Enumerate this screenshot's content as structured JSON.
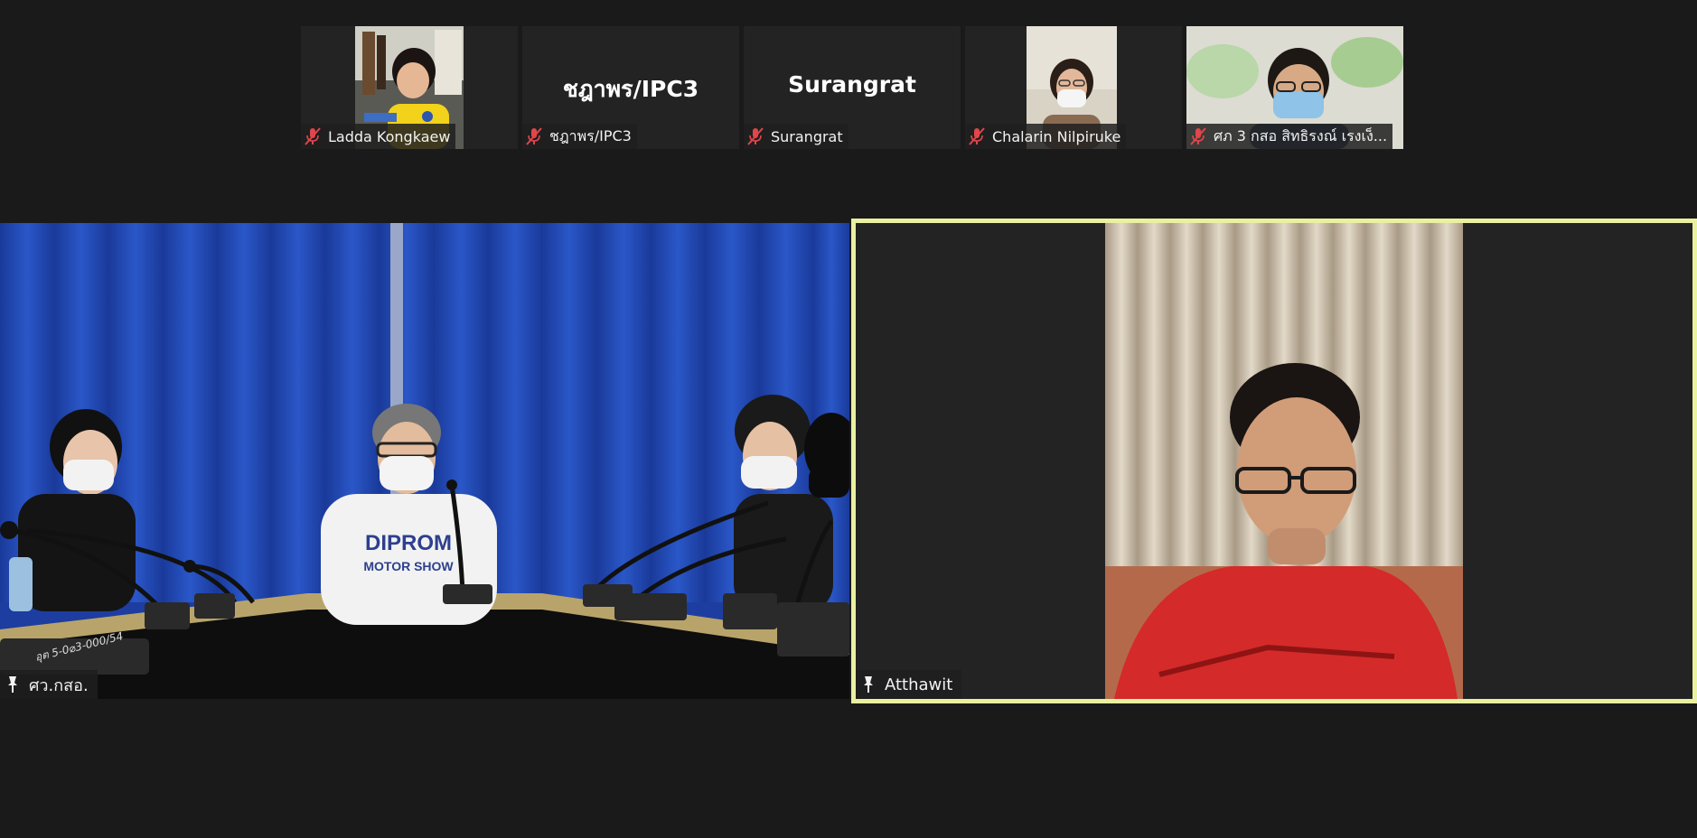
{
  "thumbnails": [
    {
      "name": "Ladda Kongkaew",
      "has_video": true
    },
    {
      "name": "ชฎาพร/IPC3",
      "center_text": "ชฎาพร/IPC3",
      "has_video": false
    },
    {
      "name": "Surangrat",
      "center_text": "Surangrat",
      "has_video": false
    },
    {
      "name": "Chalarin Nilpiruke",
      "has_video": true
    },
    {
      "name": "ศภ 3 กสอ สิทธิรงณ์  เรงเง็...",
      "has_video": true
    }
  ],
  "main": {
    "left": {
      "name": "ศว.กสอ.",
      "badge_text": "DIPROM",
      "badge_sub": "MOTOR SHOW",
      "mic_tag": "อุต 5-0⌀3-000/54"
    },
    "right": {
      "name": "Atthawit",
      "active_speaker": true
    }
  },
  "colors": {
    "active_border": "#e9f0a0",
    "muted_icon": "#e0464a",
    "tile_bg": "#232323",
    "page_bg": "#1a1a1a"
  }
}
